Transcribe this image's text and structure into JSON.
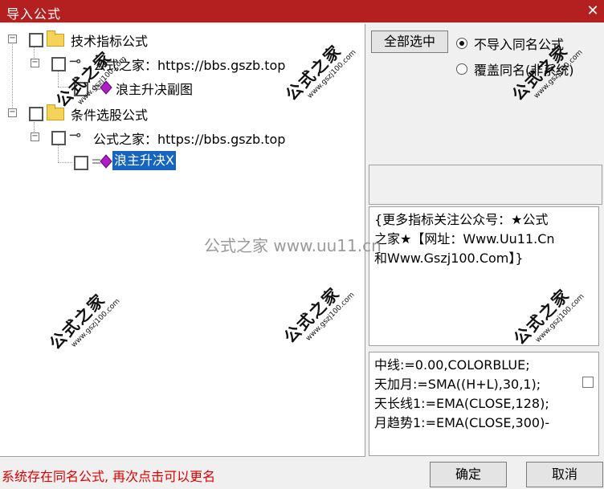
{
  "window": {
    "title": "导入公式",
    "close_glyph": "✕"
  },
  "tree": {
    "nodes": [
      {
        "label": "技术指标公式",
        "icon": "folder-icon"
      },
      {
        "label": "公式之家：https://bbs.gszb.top",
        "icon": "key-icon"
      },
      {
        "label": "浪主升决副图",
        "icon": "formula-icon"
      },
      {
        "label": "条件选股公式",
        "icon": "folder-icon"
      },
      {
        "label": "公式之家：https://bbs.gszb.top",
        "icon": "key-icon"
      },
      {
        "label": "浪主升决X",
        "icon": "formula-icon",
        "selected": true
      }
    ],
    "expander_glyph": "−",
    "key_glyph": "⊸"
  },
  "options": {
    "select_all_label": "全部选中",
    "radio_no_import": "不导入同名公式",
    "radio_overwrite": "覆盖同名(非系统)",
    "selected_radio": "no_import"
  },
  "description": {
    "line1": "{更多指标关注公众号：★公式",
    "line2": "之家★【网址：Www.Uu11.Cn",
    "line3": "和Www.Gszj100.Com】}"
  },
  "code": {
    "lines": [
      "中线:=0.00,COLORBLUE;",
      "天加月:=SMA((H+L),30,1);",
      "天长线1:=EMA(CLOSE,128);",
      "月趋势1:=EMA(CLOSE,300)-"
    ]
  },
  "status_message": "系统存在同名公式, 再次点击可以更名",
  "buttons": {
    "ok": "确定",
    "cancel": "取消"
  },
  "watermarks": {
    "big": "公式之家",
    "small": "www.gszj100.com",
    "center": "公式之家 www.uu11.cn"
  },
  "colors": {
    "titlebar": "#b3201f",
    "selection": "#1565c0",
    "status": "#e00000"
  }
}
